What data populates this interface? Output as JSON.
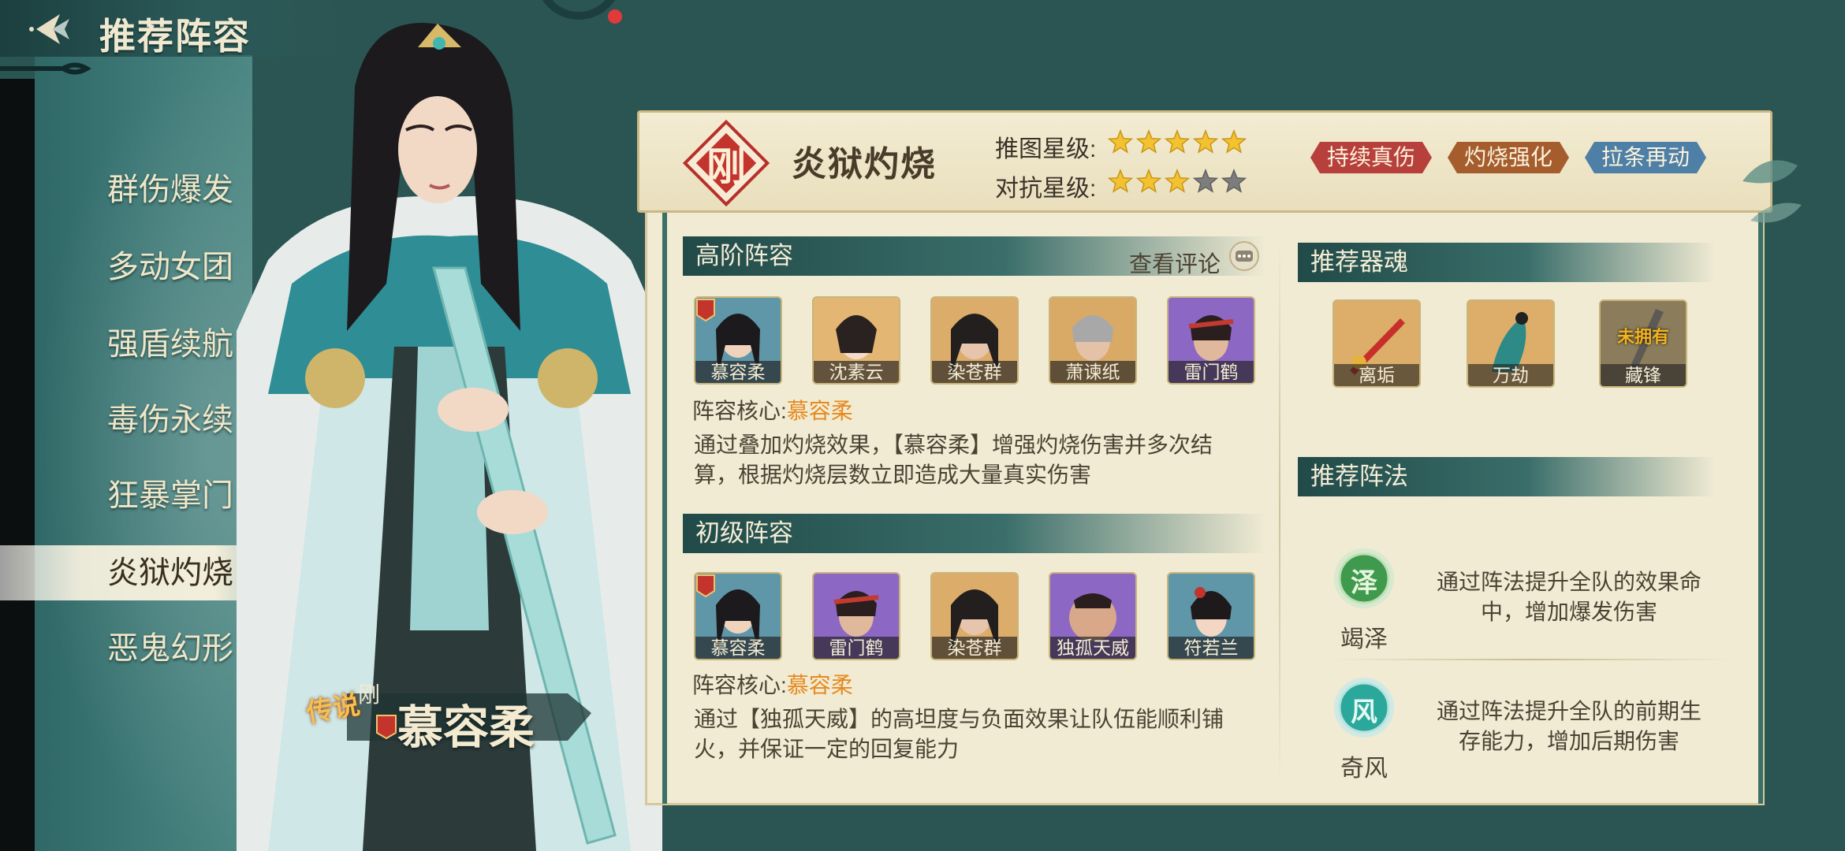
{
  "header": {
    "title": "推荐阵容"
  },
  "menu": {
    "items": [
      {
        "label": "群伤爆发",
        "active": false
      },
      {
        "label": "多动女团",
        "active": false
      },
      {
        "label": "强盾续航",
        "active": false
      },
      {
        "label": "毒伤永续",
        "active": false
      },
      {
        "label": "狂暴掌门",
        "active": false
      },
      {
        "label": "炎狱灼烧",
        "active": true
      },
      {
        "label": "恶鬼幻形",
        "active": false
      }
    ]
  },
  "character": {
    "legend_label": "传说",
    "class_label": "刚",
    "name": "慕容柔"
  },
  "formation": {
    "class_glyph": "刚",
    "name": "炎狱灼烧",
    "push_star_label": "推图星级:",
    "push_stars": 5,
    "pvp_star_label": "对抗星级:",
    "pvp_stars": 3,
    "max_stars": 5,
    "tags": [
      {
        "label": "持续真伤",
        "color": "#b8403c"
      },
      {
        "label": "灼烧强化",
        "color": "#a55d2e"
      },
      {
        "label": "拉条再动",
        "color": "#4e7fa6"
      }
    ]
  },
  "advanced": {
    "title": "高阶阵容",
    "view_comments": "查看评论",
    "heroes": [
      "慕容柔",
      "沈素云",
      "染苍群",
      "萧谏纸",
      "雷门鹤"
    ],
    "core_label": "阵容核心:",
    "core_name": "慕容柔",
    "description": "通过叠加灼烧效果，【慕容柔】增强灼烧伤害并多次结算，根据灼烧层数立即造成大量真实伤害"
  },
  "beginner": {
    "title": "初级阵容",
    "heroes": [
      "慕容柔",
      "雷门鹤",
      "染苍群",
      "独孤天威",
      "符若兰"
    ],
    "core_label": "阵容核心:",
    "core_name": "慕容柔",
    "description": "通过【独孤天威】的高坦度与负面效果让队伍能顺利铺火，并保证一定的回复能力"
  },
  "artifacts": {
    "title": "推荐器魂",
    "items": [
      {
        "name": "离垢",
        "owned": true
      },
      {
        "name": "万劫",
        "owned": true
      },
      {
        "name": "藏锋",
        "owned": false
      }
    ],
    "unowned_label": "未拥有"
  },
  "arrays": {
    "title": "推荐阵法",
    "items": [
      {
        "glyph": "泽",
        "name": "竭泽",
        "description": "通过阵法提升全队的效果命中，增加爆发伤害",
        "color": "#3f9a4e"
      },
      {
        "glyph": "风",
        "name": "奇风",
        "description": "通过阵法提升全队的前期生存能力，增加后期伤害",
        "color": "#2aa89c"
      }
    ]
  }
}
